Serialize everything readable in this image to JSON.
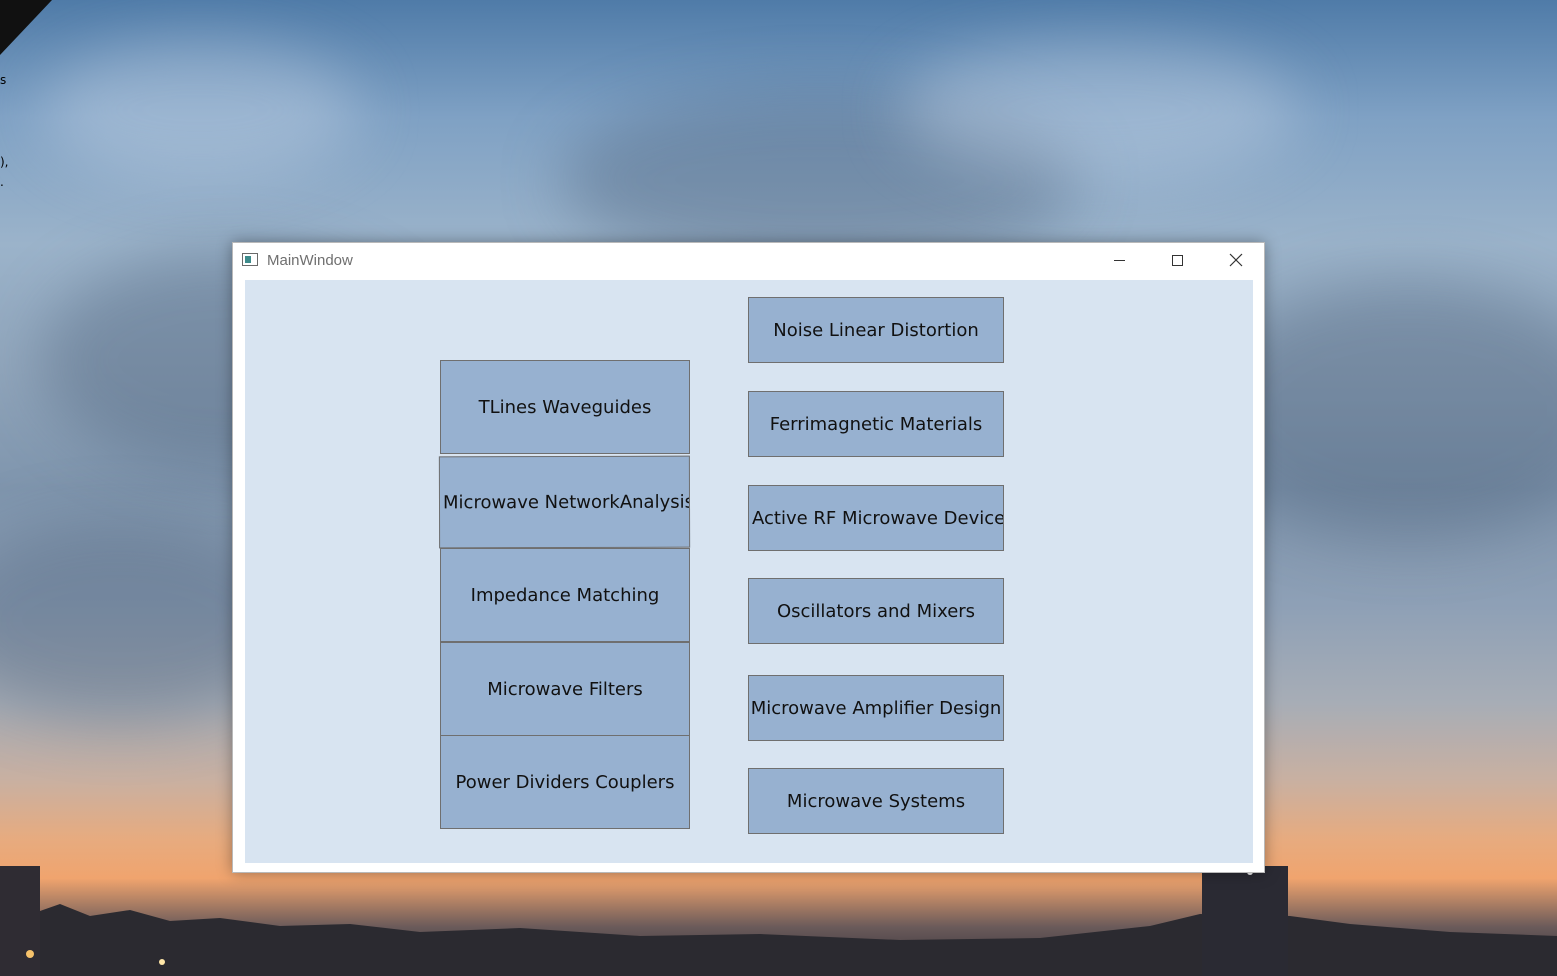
{
  "desktop": {
    "edge_texts": [
      "s",
      "),",
      "."
    ]
  },
  "window": {
    "title": "MainWindow",
    "controls": {
      "minimize": "minimize",
      "maximize": "maximize",
      "close": "close"
    }
  },
  "left_column": [
    {
      "label": "TLines Waveguides"
    },
    {
      "label": "Microwave NetworkAnalysis"
    },
    {
      "label": "Impedance Matching"
    },
    {
      "label": "Microwave Filters"
    },
    {
      "label": "Power Dividers Couplers"
    }
  ],
  "right_column": [
    {
      "label": "Noise Linear Distortion"
    },
    {
      "label": "Ferrimagnetic Materials"
    },
    {
      "label": "Active RF Microwave Devices"
    },
    {
      "label": "Oscillators and Mixers"
    },
    {
      "label": "Microwave Amplifier Design"
    },
    {
      "label": "Microwave Systems"
    }
  ],
  "colors": {
    "button_bg": "#97b1d0",
    "client_bg": "#d8e4f1",
    "titlebar_bg": "#ffffff"
  }
}
